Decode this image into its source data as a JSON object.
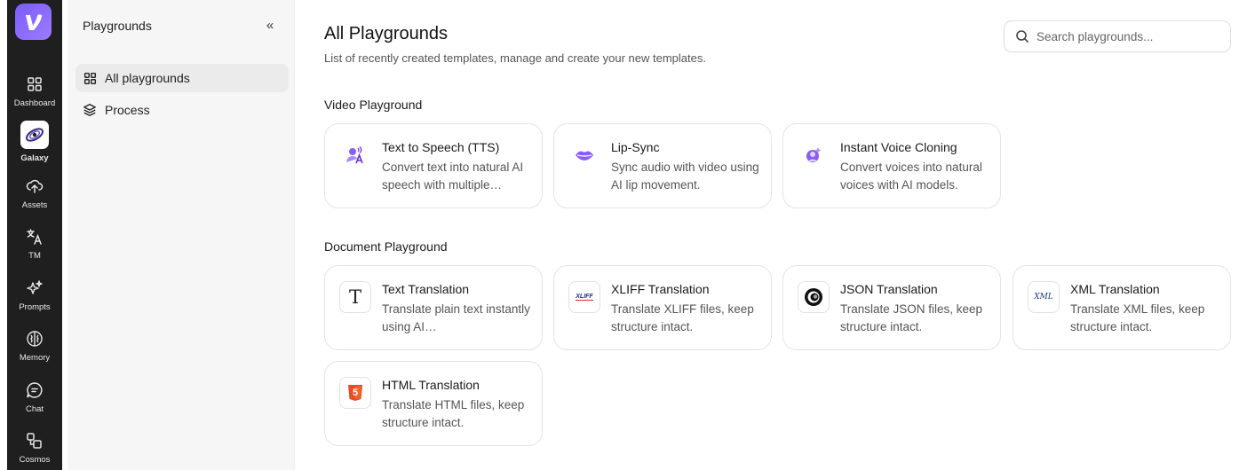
{
  "rail": {
    "items": [
      {
        "label": "Dashboard",
        "icon": "grid-icon"
      },
      {
        "label": "Galaxy",
        "icon": "galaxy-icon"
      },
      {
        "label": "Assets",
        "icon": "upload-cloud-icon"
      },
      {
        "label": "TM",
        "icon": "translate-icon"
      },
      {
        "label": "Prompts",
        "icon": "sparkles-icon"
      },
      {
        "label": "Memory",
        "icon": "brain-icon"
      },
      {
        "label": "Chat",
        "icon": "chat-icon"
      },
      {
        "label": "Cosmos",
        "icon": "shapes-icon"
      }
    ]
  },
  "subnav": {
    "title": "Playgrounds",
    "collapse_glyph": "«",
    "items": [
      {
        "label": "All playgrounds",
        "icon": "grid-icon"
      },
      {
        "label": "Process",
        "icon": "layers-icon"
      }
    ]
  },
  "main": {
    "title": "All Playgrounds",
    "subtitle": "List of recently created templates, manage and create your new templates.",
    "search": {
      "placeholder": "Search playgrounds..."
    },
    "sections": [
      {
        "title": "Video Playground",
        "cards": [
          {
            "title": "Text to Speech (TTS)",
            "desc": "Convert text into natural AI speech with multiple…",
            "icon": "speech-icon"
          },
          {
            "title": "Lip-Sync",
            "desc": "Sync audio with video using AI lip movement.",
            "icon": "lips-icon"
          },
          {
            "title": "Instant Voice Cloning",
            "desc": "Convert voices into natural voices with AI models.",
            "icon": "voice-clone-icon"
          }
        ]
      },
      {
        "title": "Document Playground",
        "cards": [
          {
            "title": "Text Translation",
            "desc": "Translate plain text instantly using AI…",
            "icon": "text-t-icon",
            "glyph": "T"
          },
          {
            "title": "XLIFF Translation",
            "desc": "Translate XLIFF files, keep structure intact.",
            "icon": "xliff-icon",
            "glyph": "XLIFF"
          },
          {
            "title": "JSON Translation",
            "desc": "Translate JSON files, keep structure intact.",
            "icon": "json-icon"
          },
          {
            "title": "XML Translation",
            "desc": "Translate XML files, keep structure intact.",
            "icon": "xml-icon",
            "glyph": "XML"
          },
          {
            "title": "HTML Translation",
            "desc": "Translate HTML files, keep structure intact.",
            "icon": "html5-icon",
            "glyph": "5"
          }
        ]
      }
    ]
  },
  "colors": {
    "accent": "#7c5cff",
    "rail_bg": "#1f1f1f",
    "subnav_bg": "#f6f6f6"
  }
}
